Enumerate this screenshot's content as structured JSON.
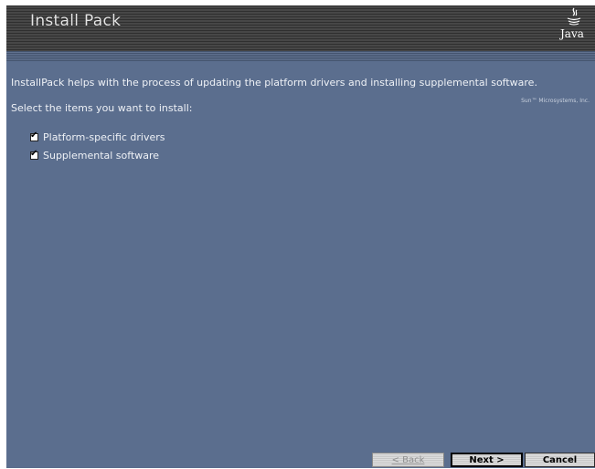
{
  "header": {
    "title": "Install Pack",
    "logo_text": "Java",
    "vendor": "Sun™ Microsystems, Inc."
  },
  "content": {
    "intro": "InstallPack helps with the process of updating the platform drivers and installing supplemental software.",
    "prompt": "Select the items you want to install:",
    "options": [
      {
        "label": "Platform-specific drivers",
        "checked": true
      },
      {
        "label": "Supplemental software",
        "checked": true
      }
    ]
  },
  "footer": {
    "back_label": "< Back",
    "next_label": "Next >",
    "cancel_label": "Cancel"
  },
  "colors": {
    "panel": "#5b6e8e",
    "header": "#3b3b3b"
  }
}
